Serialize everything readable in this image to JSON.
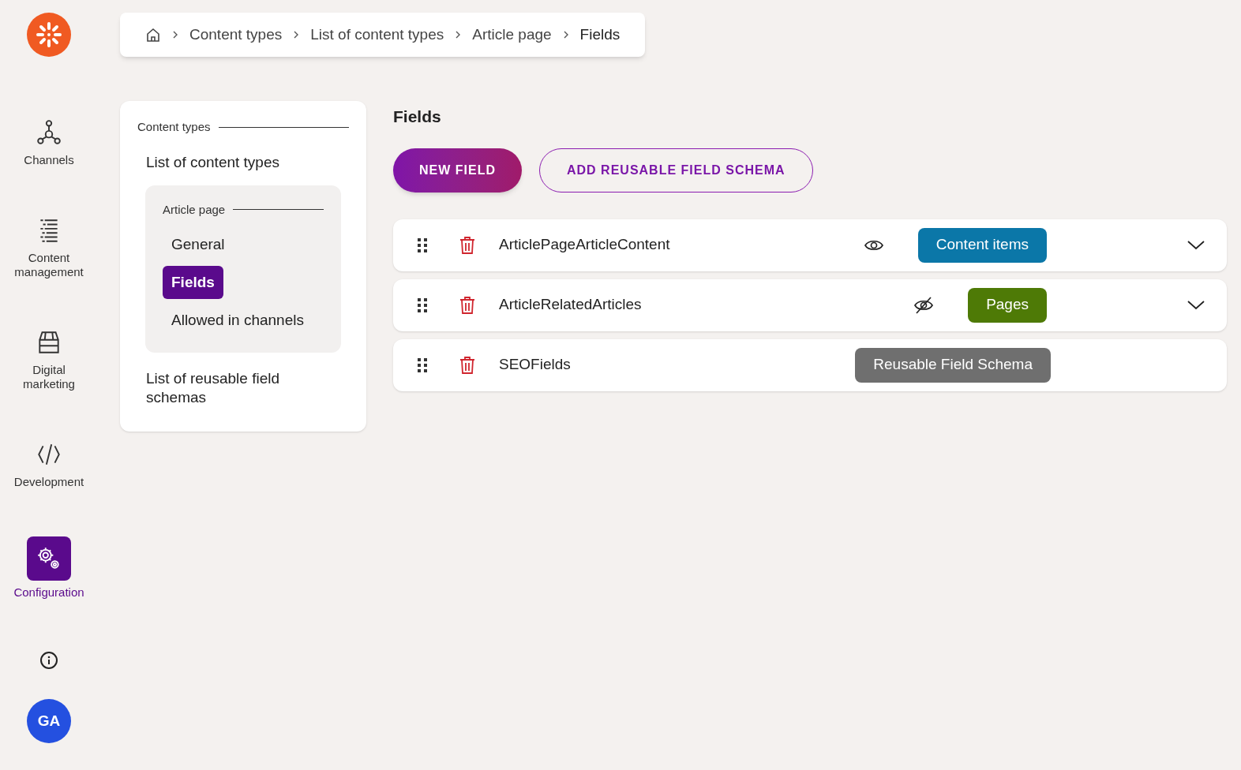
{
  "nav": {
    "items": [
      {
        "label": "Channels",
        "selected": false
      },
      {
        "label": "Content management",
        "selected": false
      },
      {
        "label": "Digital marketing",
        "selected": false
      },
      {
        "label": "Development",
        "selected": false
      },
      {
        "label": "Configuration",
        "selected": true
      }
    ],
    "avatar": "GA"
  },
  "breadcrumb": [
    "Content types",
    "List of content types",
    "Article page",
    "Fields"
  ],
  "side_menu": {
    "heading": "Content types",
    "items": [
      {
        "label": "List of content types",
        "selected": false,
        "children_heading": "Article page",
        "children": [
          {
            "label": "General",
            "selected": false
          },
          {
            "label": "Fields",
            "selected": true
          },
          {
            "label": "Allowed in channels",
            "selected": false
          }
        ]
      },
      {
        "label": "List of reusable field schemas",
        "selected": false
      }
    ]
  },
  "title": "Fields",
  "buttons": [
    {
      "label": "NEW FIELD",
      "kind": "primary"
    },
    {
      "label": "ADD REUSABLE FIELD SCHEMA",
      "kind": "outline"
    }
  ],
  "fields": [
    {
      "name": "ArticlePageArticleContent",
      "visible": true,
      "badge": "Content items",
      "color": "#0b77a8",
      "expandable": true
    },
    {
      "name": "ArticleRelatedArticles",
      "visible": false,
      "badge": "Pages",
      "color": "#4e7a06",
      "expandable": true
    },
    {
      "name": "SEOFields",
      "badge": "Reusable Field Schema",
      "color": "#6f6f6f",
      "expandable": false
    }
  ]
}
